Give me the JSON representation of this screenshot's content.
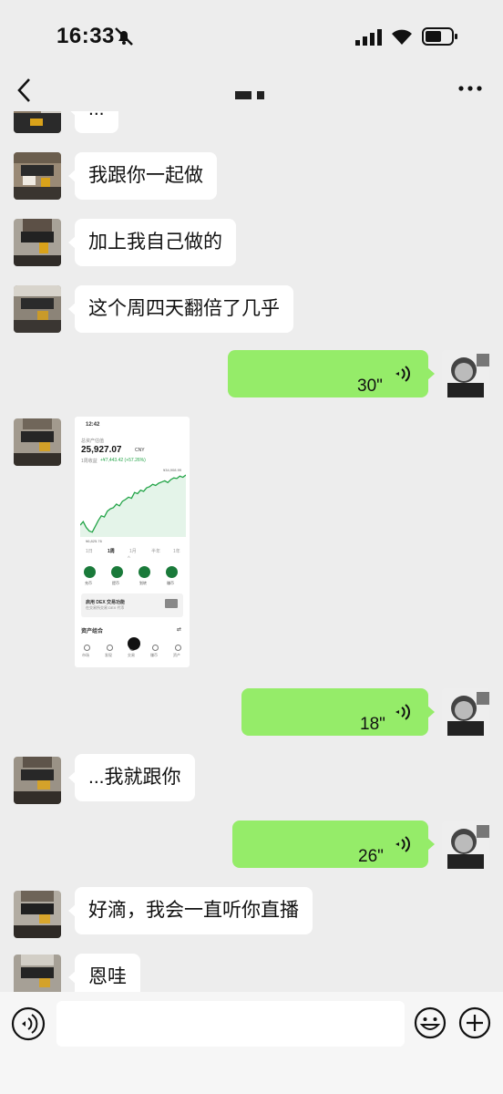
{
  "status_bar": {
    "time": "16:33"
  },
  "messages": [
    {
      "side": "left",
      "type": "text",
      "text": "..."
    },
    {
      "side": "left",
      "type": "text",
      "text": "我跟你一起做"
    },
    {
      "side": "left",
      "type": "text",
      "text": "加上我自己做的"
    },
    {
      "side": "left",
      "type": "text",
      "text": "这个周四天翻倍了几乎"
    },
    {
      "side": "right",
      "type": "voice",
      "duration": "30\""
    },
    {
      "side": "left",
      "type": "image"
    },
    {
      "side": "right",
      "type": "voice",
      "duration": "18\""
    },
    {
      "side": "left",
      "type": "text",
      "text": "...我就跟你"
    },
    {
      "side": "right",
      "type": "voice",
      "duration": "26\""
    },
    {
      "side": "left",
      "type": "text",
      "text": "好滴，我会一直听你直播"
    },
    {
      "side": "left",
      "type": "text",
      "text": "恩哇"
    }
  ],
  "shared_screenshot": {
    "time": "12:42",
    "balance_label": "总资产估值",
    "balance": "25,927.07",
    "currency": "CNY",
    "change_label": "1周收益",
    "change": "+¥7,443.42 (+57.26%)",
    "chart_high": "¥34,908.99",
    "chart_low": "¥6,825.76",
    "chart_points": [
      0.14,
      0.2,
      0.1,
      0.04,
      0.02,
      0.12,
      0.22,
      0.3,
      0.28,
      0.38,
      0.42,
      0.44,
      0.5,
      0.47,
      0.55,
      0.58,
      0.62,
      0.6,
      0.7,
      0.68,
      0.74,
      0.72,
      0.78,
      0.8,
      0.84,
      0.82,
      0.86,
      0.88,
      0.9,
      0.87,
      0.92,
      0.95,
      0.94,
      0.98,
      0.96,
      1.0
    ],
    "ranges": [
      "1日",
      "1周",
      "1月",
      "半年",
      "1年"
    ],
    "actions": [
      "充币",
      "提币",
      "划转",
      "赚币"
    ],
    "banner_title": "启用 DEX 交易功能",
    "banner_sub": "在交易所交易 DEX 代币",
    "portfolio_label": "资产组合",
    "tabs": [
      "市场",
      "发现",
      "交易",
      "赚币",
      "资产"
    ]
  },
  "input_bar": {
    "placeholder": ""
  },
  "colors": {
    "bubble_green": "#95ec69",
    "chart_green": "#22a447",
    "background": "#ededed"
  }
}
